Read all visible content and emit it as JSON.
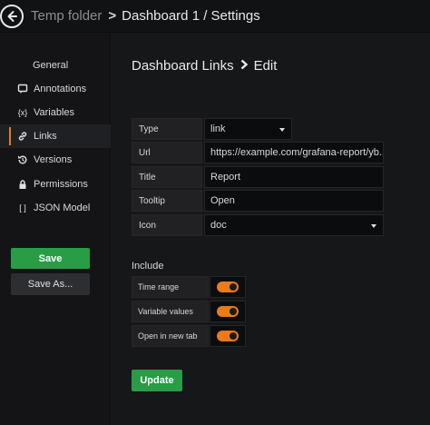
{
  "breadcrumb": {
    "folder": "Temp folder",
    "separator": ">",
    "dashboard": "Dashboard 1 / Settings"
  },
  "sidebar": {
    "heading": "General",
    "items": [
      {
        "label": "Annotations",
        "icon": "comment-icon"
      },
      {
        "label": "Variables",
        "icon": "variable-icon"
      },
      {
        "label": "Links",
        "icon": "link-icon",
        "active": true
      },
      {
        "label": "Versions",
        "icon": "history-icon"
      },
      {
        "label": "Permissions",
        "icon": "lock-icon"
      },
      {
        "label": "JSON Model",
        "icon": "json-icon"
      }
    ],
    "save_label": "Save",
    "save_as_label": "Save As..."
  },
  "page": {
    "title_part1": "Dashboard Links",
    "title_part2": "Edit"
  },
  "form": {
    "type": {
      "label": "Type",
      "value": "link"
    },
    "url": {
      "label": "Url",
      "value": "https://example.com/grafana-report/yb..."
    },
    "title": {
      "label": "Title",
      "value": "Report"
    },
    "tooltip": {
      "label": "Tooltip",
      "value": "Open"
    },
    "icon": {
      "label": "Icon",
      "value": "doc"
    }
  },
  "include": {
    "title": "Include",
    "options": [
      {
        "label": "Time range",
        "enabled": true
      },
      {
        "label": "Variable values",
        "enabled": true
      },
      {
        "label": "Open in new tab",
        "enabled": true
      }
    ]
  },
  "update_label": "Update",
  "colors": {
    "accent": "#eb7b18",
    "primary_button": "#299c46",
    "background": "#161719"
  }
}
